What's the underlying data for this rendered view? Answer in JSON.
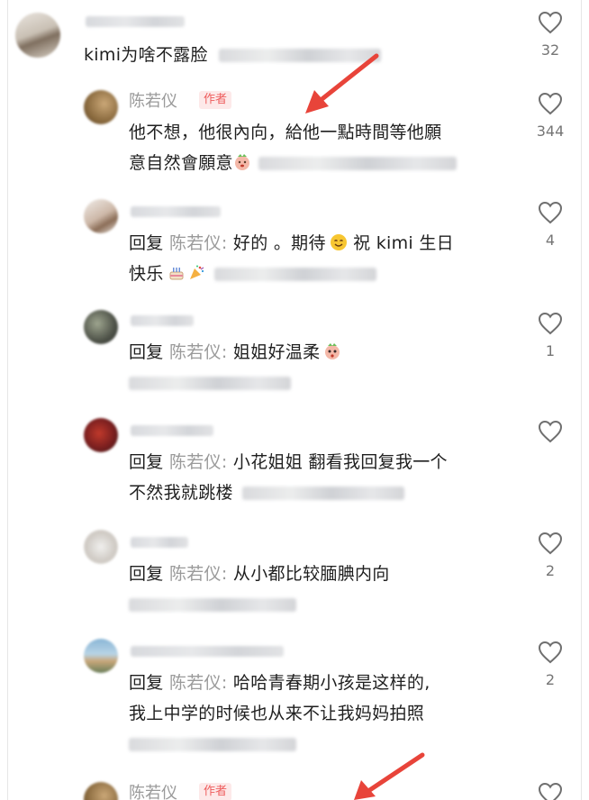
{
  "top_comment": {
    "text": "kimi为啥不露脸",
    "likes": "32"
  },
  "comments": [
    {
      "author": "陈若仪",
      "badge": "作者",
      "line1": "他不想，他很內向，給他一點時間等他願",
      "line2": "意自然會願意",
      "likes": "344"
    },
    {
      "reply_prefix": "回复",
      "reply_to": "陈若仪:",
      "line1": " 好的 。期待",
      "line1b": " 祝 kimi 生日",
      "line2": "快乐",
      "likes": "4"
    },
    {
      "reply_prefix": "回复",
      "reply_to": "陈若仪:",
      "line1": " 姐姐好温柔",
      "likes": "1"
    },
    {
      "reply_prefix": "回复",
      "reply_to": "陈若仪:",
      "line1": " 小花姐姐 翻看我回复我一个",
      "line2": "不然我就跳楼",
      "likes": ""
    },
    {
      "reply_prefix": "回复",
      "reply_to": "陈若仪:",
      "line1": " 从小都比较腼腆内向",
      "likes": "2"
    },
    {
      "reply_prefix": "回复",
      "reply_to": "陈若仪:",
      "line1": " 哈哈青春期小孩是这样的,",
      "line2": "我上中学的时候也从来不让我妈妈拍照",
      "likes": "2"
    },
    {
      "author": "陈若仪",
      "badge": "作者"
    }
  ],
  "colors": {
    "annotation_arrow": "#e8443a",
    "author_tag_text": "#ee5d5d",
    "author_tag_bg": "#fde9e9",
    "muted": "#9a9a9a"
  },
  "icons": [
    "heart-outline-icon",
    "relieved-face-emoji",
    "smile-emoji",
    "cake-emoji",
    "party-popper-emoji",
    "pleading-face-emoji"
  ]
}
